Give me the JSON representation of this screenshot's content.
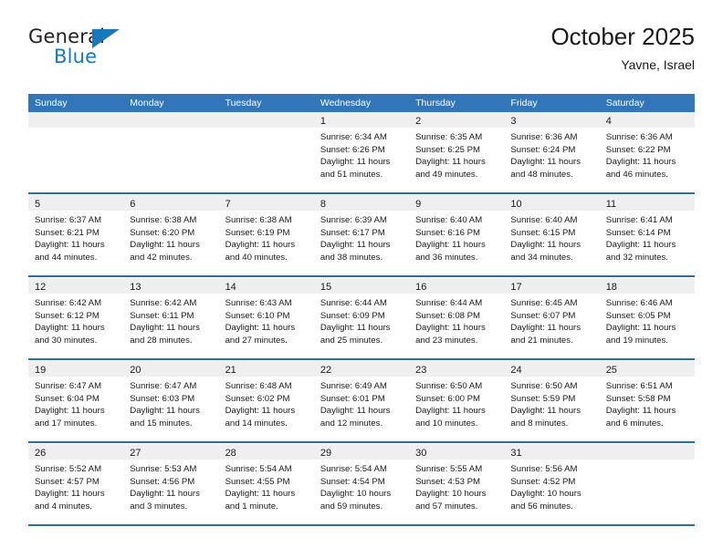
{
  "brand": {
    "name_top": "General",
    "name_bottom": "Blue",
    "triangle_color": "#1878be",
    "text_color": "#231f20"
  },
  "header": {
    "title": "October 2025",
    "location": "Yavne, Israel",
    "header_bg": "#3275b8",
    "header_text": "#ffffff",
    "daynum_band_bg": "#efefef",
    "week_separator_color": "#2e6da4"
  },
  "weekdays": [
    "Sunday",
    "Monday",
    "Tuesday",
    "Wednesday",
    "Thursday",
    "Friday",
    "Saturday"
  ],
  "weeks": [
    [
      {
        "day": "",
        "sunrise": "",
        "sunset": "",
        "daylight1": "",
        "daylight2": "",
        "empty": true
      },
      {
        "day": "",
        "sunrise": "",
        "sunset": "",
        "daylight1": "",
        "daylight2": "",
        "empty": true
      },
      {
        "day": "",
        "sunrise": "",
        "sunset": "",
        "daylight1": "",
        "daylight2": "",
        "empty": true
      },
      {
        "day": "1",
        "sunrise": "Sunrise: 6:34 AM",
        "sunset": "Sunset: 6:26 PM",
        "daylight1": "Daylight: 11 hours",
        "daylight2": "and 51 minutes."
      },
      {
        "day": "2",
        "sunrise": "Sunrise: 6:35 AM",
        "sunset": "Sunset: 6:25 PM",
        "daylight1": "Daylight: 11 hours",
        "daylight2": "and 49 minutes."
      },
      {
        "day": "3",
        "sunrise": "Sunrise: 6:36 AM",
        "sunset": "Sunset: 6:24 PM",
        "daylight1": "Daylight: 11 hours",
        "daylight2": "and 48 minutes."
      },
      {
        "day": "4",
        "sunrise": "Sunrise: 6:36 AM",
        "sunset": "Sunset: 6:22 PM",
        "daylight1": "Daylight: 11 hours",
        "daylight2": "and 46 minutes."
      }
    ],
    [
      {
        "day": "5",
        "sunrise": "Sunrise: 6:37 AM",
        "sunset": "Sunset: 6:21 PM",
        "daylight1": "Daylight: 11 hours",
        "daylight2": "and 44 minutes."
      },
      {
        "day": "6",
        "sunrise": "Sunrise: 6:38 AM",
        "sunset": "Sunset: 6:20 PM",
        "daylight1": "Daylight: 11 hours",
        "daylight2": "and 42 minutes."
      },
      {
        "day": "7",
        "sunrise": "Sunrise: 6:38 AM",
        "sunset": "Sunset: 6:19 PM",
        "daylight1": "Daylight: 11 hours",
        "daylight2": "and 40 minutes."
      },
      {
        "day": "8",
        "sunrise": "Sunrise: 6:39 AM",
        "sunset": "Sunset: 6:17 PM",
        "daylight1": "Daylight: 11 hours",
        "daylight2": "and 38 minutes."
      },
      {
        "day": "9",
        "sunrise": "Sunrise: 6:40 AM",
        "sunset": "Sunset: 6:16 PM",
        "daylight1": "Daylight: 11 hours",
        "daylight2": "and 36 minutes."
      },
      {
        "day": "10",
        "sunrise": "Sunrise: 6:40 AM",
        "sunset": "Sunset: 6:15 PM",
        "daylight1": "Daylight: 11 hours",
        "daylight2": "and 34 minutes."
      },
      {
        "day": "11",
        "sunrise": "Sunrise: 6:41 AM",
        "sunset": "Sunset: 6:14 PM",
        "daylight1": "Daylight: 11 hours",
        "daylight2": "and 32 minutes."
      }
    ],
    [
      {
        "day": "12",
        "sunrise": "Sunrise: 6:42 AM",
        "sunset": "Sunset: 6:12 PM",
        "daylight1": "Daylight: 11 hours",
        "daylight2": "and 30 minutes."
      },
      {
        "day": "13",
        "sunrise": "Sunrise: 6:42 AM",
        "sunset": "Sunset: 6:11 PM",
        "daylight1": "Daylight: 11 hours",
        "daylight2": "and 28 minutes."
      },
      {
        "day": "14",
        "sunrise": "Sunrise: 6:43 AM",
        "sunset": "Sunset: 6:10 PM",
        "daylight1": "Daylight: 11 hours",
        "daylight2": "and 27 minutes."
      },
      {
        "day": "15",
        "sunrise": "Sunrise: 6:44 AM",
        "sunset": "Sunset: 6:09 PM",
        "daylight1": "Daylight: 11 hours",
        "daylight2": "and 25 minutes."
      },
      {
        "day": "16",
        "sunrise": "Sunrise: 6:44 AM",
        "sunset": "Sunset: 6:08 PM",
        "daylight1": "Daylight: 11 hours",
        "daylight2": "and 23 minutes."
      },
      {
        "day": "17",
        "sunrise": "Sunrise: 6:45 AM",
        "sunset": "Sunset: 6:07 PM",
        "daylight1": "Daylight: 11 hours",
        "daylight2": "and 21 minutes."
      },
      {
        "day": "18",
        "sunrise": "Sunrise: 6:46 AM",
        "sunset": "Sunset: 6:05 PM",
        "daylight1": "Daylight: 11 hours",
        "daylight2": "and 19 minutes."
      }
    ],
    [
      {
        "day": "19",
        "sunrise": "Sunrise: 6:47 AM",
        "sunset": "Sunset: 6:04 PM",
        "daylight1": "Daylight: 11 hours",
        "daylight2": "and 17 minutes."
      },
      {
        "day": "20",
        "sunrise": "Sunrise: 6:47 AM",
        "sunset": "Sunset: 6:03 PM",
        "daylight1": "Daylight: 11 hours",
        "daylight2": "and 15 minutes."
      },
      {
        "day": "21",
        "sunrise": "Sunrise: 6:48 AM",
        "sunset": "Sunset: 6:02 PM",
        "daylight1": "Daylight: 11 hours",
        "daylight2": "and 14 minutes."
      },
      {
        "day": "22",
        "sunrise": "Sunrise: 6:49 AM",
        "sunset": "Sunset: 6:01 PM",
        "daylight1": "Daylight: 11 hours",
        "daylight2": "and 12 minutes."
      },
      {
        "day": "23",
        "sunrise": "Sunrise: 6:50 AM",
        "sunset": "Sunset: 6:00 PM",
        "daylight1": "Daylight: 11 hours",
        "daylight2": "and 10 minutes."
      },
      {
        "day": "24",
        "sunrise": "Sunrise: 6:50 AM",
        "sunset": "Sunset: 5:59 PM",
        "daylight1": "Daylight: 11 hours",
        "daylight2": "and 8 minutes."
      },
      {
        "day": "25",
        "sunrise": "Sunrise: 6:51 AM",
        "sunset": "Sunset: 5:58 PM",
        "daylight1": "Daylight: 11 hours",
        "daylight2": "and 6 minutes."
      }
    ],
    [
      {
        "day": "26",
        "sunrise": "Sunrise: 5:52 AM",
        "sunset": "Sunset: 4:57 PM",
        "daylight1": "Daylight: 11 hours",
        "daylight2": "and 4 minutes."
      },
      {
        "day": "27",
        "sunrise": "Sunrise: 5:53 AM",
        "sunset": "Sunset: 4:56 PM",
        "daylight1": "Daylight: 11 hours",
        "daylight2": "and 3 minutes."
      },
      {
        "day": "28",
        "sunrise": "Sunrise: 5:54 AM",
        "sunset": "Sunset: 4:55 PM",
        "daylight1": "Daylight: 11 hours",
        "daylight2": "and 1 minute."
      },
      {
        "day": "29",
        "sunrise": "Sunrise: 5:54 AM",
        "sunset": "Sunset: 4:54 PM",
        "daylight1": "Daylight: 10 hours",
        "daylight2": "and 59 minutes."
      },
      {
        "day": "30",
        "sunrise": "Sunrise: 5:55 AM",
        "sunset": "Sunset: 4:53 PM",
        "daylight1": "Daylight: 10 hours",
        "daylight2": "and 57 minutes."
      },
      {
        "day": "31",
        "sunrise": "Sunrise: 5:56 AM",
        "sunset": "Sunset: 4:52 PM",
        "daylight1": "Daylight: 10 hours",
        "daylight2": "and 56 minutes."
      },
      {
        "day": "",
        "sunrise": "",
        "sunset": "",
        "daylight1": "",
        "daylight2": "",
        "empty": true
      }
    ]
  ]
}
